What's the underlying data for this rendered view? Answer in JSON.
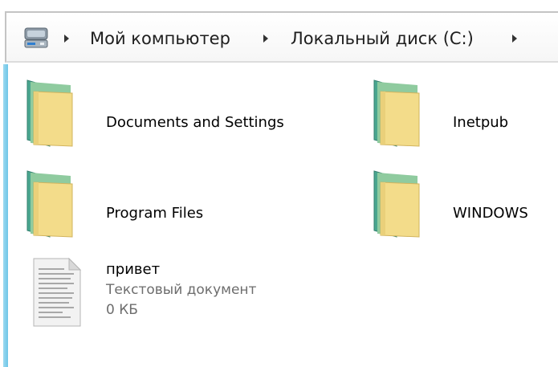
{
  "breadcrumb": {
    "items": [
      {
        "label": "Мой компьютер"
      },
      {
        "label": "Локальный диск (C:)"
      }
    ]
  },
  "files": {
    "folders": [
      {
        "name": "Documents and Settings"
      },
      {
        "name": "Inetpub"
      },
      {
        "name": "Program Files"
      },
      {
        "name": "WINDOWS"
      }
    ],
    "document": {
      "name": "привет",
      "type": "Текстовый документ",
      "size": "0 КБ"
    }
  },
  "icons": {
    "computer": "computer-icon",
    "folder": "folder-icon",
    "text_document": "text-document-icon",
    "chevron": "chevron-right-icon"
  },
  "colors": {
    "accent": "#6ec6e8",
    "folder_front": "#f3dc8a",
    "folder_back": "#4aa68f"
  }
}
